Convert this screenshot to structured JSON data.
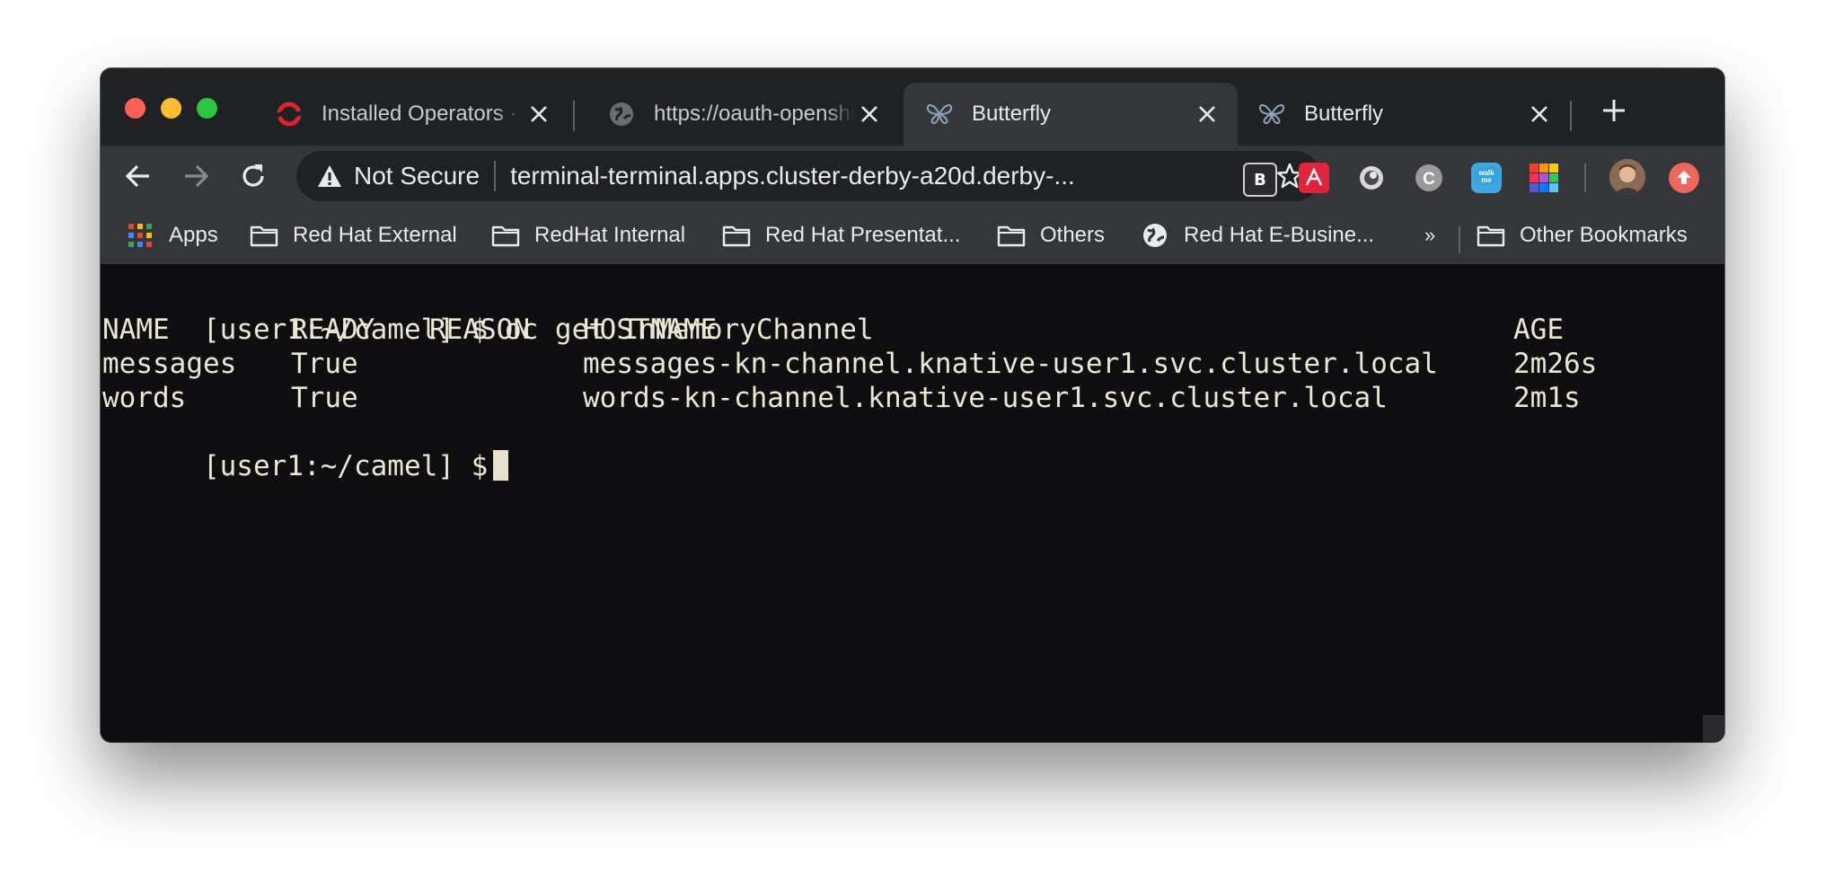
{
  "window": {
    "tabs": [
      {
        "title": "Installed Operators · Red Hat OpenShift",
        "icon": "openshift-logo-icon",
        "active": false
      },
      {
        "title": "https://oauth-openshift",
        "icon": "globe-icon",
        "active": false
      },
      {
        "title": "Butterfly",
        "icon": "butterfly-icon",
        "active": true
      },
      {
        "title": "Butterfly",
        "icon": "butterfly-icon",
        "active": false
      }
    ],
    "new_tab_icon": "plus-icon"
  },
  "toolbar": {
    "security_label": "Not Secure",
    "url": "terminal-terminal.apps.cluster-derby-a20d.derby-...",
    "extensions": [
      "bookmark-extension-icon",
      "acrobat-icon",
      "round-extension-icon",
      "c-extension-icon",
      "walkme-icon",
      "colorful-grid-icon",
      "profile-avatar",
      "update-icon"
    ]
  },
  "bookmarks": {
    "apps_label": "Apps",
    "items": [
      "Red Hat External",
      "RedHat Internal",
      "Red Hat Presentat...",
      "Others",
      "Red Hat E-Busine..."
    ],
    "overflow_label": "»",
    "other_label": "Other Bookmarks"
  },
  "terminal": {
    "prompt": "[user1:~/camel] $",
    "command": "oc get InMemoryChannel",
    "columns": [
      "NAME",
      "READY",
      "REASON",
      "HOSTNAME",
      "AGE"
    ],
    "rows": [
      [
        "messages",
        "True",
        "",
        "messages-kn-channel.knative-user1.svc.cluster.local",
        "2m26s"
      ],
      [
        "words",
        "True",
        "",
        "words-kn-channel.knative-user1.svc.cluster.local",
        "2m1s"
      ]
    ]
  },
  "colors": {
    "terminal_background": "#0f0e11",
    "terminal_text": "#ece6d4",
    "chrome_dark": "#202124",
    "chrome_toolbar": "#35363a"
  }
}
